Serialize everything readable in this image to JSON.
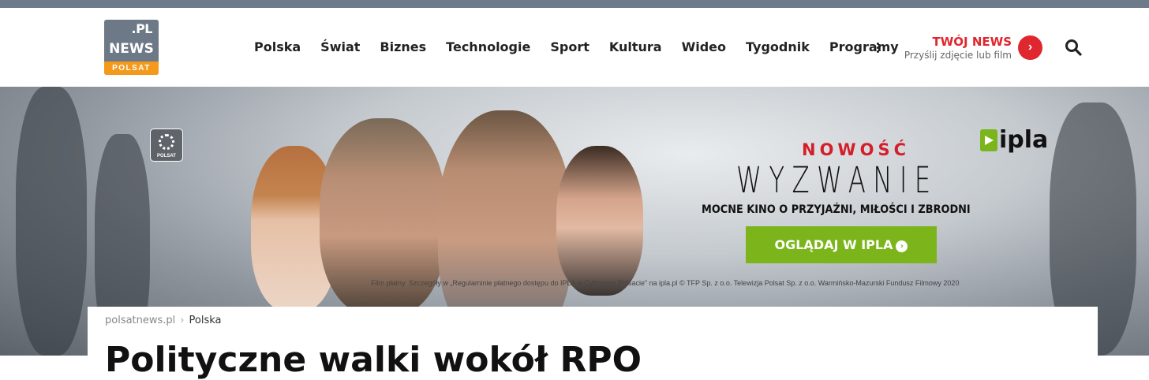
{
  "logo": {
    "pl": ".PL",
    "news": "NEWS",
    "polsat": "POLSAT"
  },
  "nav": {
    "items": [
      {
        "label": "Polska"
      },
      {
        "label": "Świat"
      },
      {
        "label": "Biznes"
      },
      {
        "label": "Technologie"
      },
      {
        "label": "Sport"
      },
      {
        "label": "Kultura"
      },
      {
        "label": "Wideo"
      },
      {
        "label": "Tygodnik"
      },
      {
        "label": "Programy"
      }
    ]
  },
  "twoj_news": {
    "title": "TWÓJ NEWS",
    "subtitle": "Przyślij zdjęcie lub film",
    "arrow": "›"
  },
  "banner": {
    "channel_logo": "POLSAT",
    "tag": "NOWOŚĆ",
    "title": "WYZWANIE",
    "subtitle": "MOCNE KINO O PRZYJAŹNI, MIŁOŚCI I ZBRODNI",
    "cta": "OGLĄDAJ W IPLA",
    "cta_arrow": "›",
    "brand": "ipla",
    "fine_print": "Film płatny. Szczegóły w „Regulaminie płatnego dostępu do IPLA w Cyfrowym Polsacie” na ipla.pl © TFP Sp. z o.o. Telewizja Polsat Sp. z o.o. Warmińsko-Mazurski Fundusz Filmowy 2020"
  },
  "breadcrumb": {
    "home": "polsatnews.pl",
    "separator": "›",
    "current": "Polska"
  },
  "article": {
    "headline": "Polityczne walki wokół RPO"
  },
  "colors": {
    "accent_red": "#e0262e",
    "ipla_green": "#7bb51b",
    "polsat_orange": "#f39a1d",
    "topbar": "#6c7a89"
  }
}
